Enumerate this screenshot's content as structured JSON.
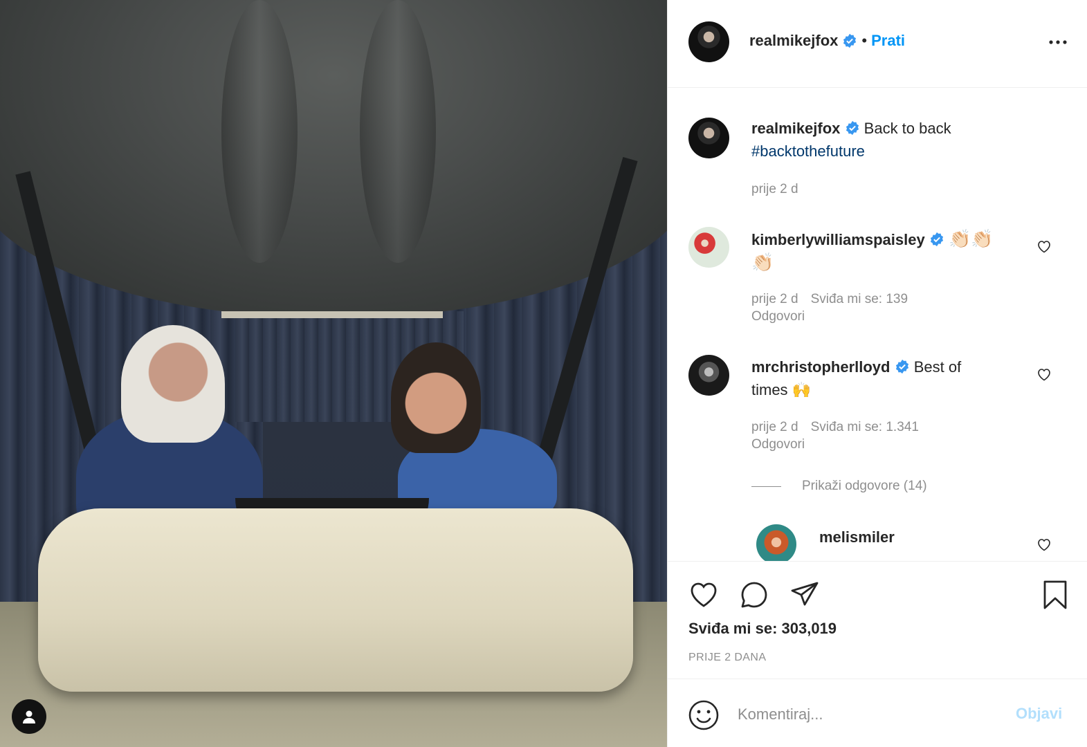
{
  "post": {
    "author": "realmikejfox",
    "follow_label": "Prati",
    "separator": "•"
  },
  "caption": {
    "username": "realmikejfox",
    "text": "Back to back",
    "hashtag": "#backtothefuture",
    "time": "prije 2 d"
  },
  "comments": [
    {
      "username": "kimberlywilliamspaisley",
      "text_line1": "👏🏻👏🏻",
      "text_line2": "👏🏻",
      "time": "prije 2 d",
      "likes": "Sviđa mi se: 139",
      "reply": "Odgovori"
    },
    {
      "username": "mrchristopherlloyd",
      "text": "Best of",
      "text_line2": "times 🙌",
      "time": "prije 2 d",
      "likes": "Sviđa mi se: 1.341",
      "reply": "Odgovori",
      "view_replies": "Prikaži odgovore (14)"
    }
  ],
  "reply": {
    "username": "melismiler"
  },
  "engagement": {
    "likes_label": "Sviđa mi se: 303,019",
    "posted_label": "PRIJE 2 DANA"
  },
  "comment_box": {
    "placeholder": "Komentiraj...",
    "post_label": "Objavi"
  },
  "icons": [
    "person-tag-icon",
    "more-options-icon",
    "verified-badge-icon",
    "heart-icon",
    "comment-icon",
    "share-icon",
    "bookmark-icon",
    "emoji-icon"
  ],
  "colors": {
    "accent": "#0095f6",
    "verified": "#3897f0",
    "muted": "#8e8e8e",
    "post_disabled": "#b2dffc"
  }
}
